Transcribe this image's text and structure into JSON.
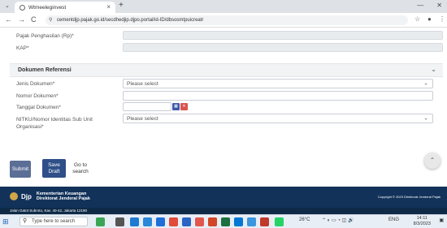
{
  "browser": {
    "tab_title": "Wtmeeleginvest",
    "url": "cementdjp.pajak.go.id/secdhedjip.djpo.portal/id-ID/dbsosmtpuicreatr",
    "new_tab": "+",
    "back": "←",
    "forward": "→",
    "reload": "C",
    "close_tab": "×",
    "tab_menu": "⌄",
    "window_controls": [
      "⌄",
      "—",
      "□",
      "✕"
    ]
  },
  "form": {
    "pph_label": "Pajak Penghasilan (Rp)*",
    "kap_label": "KAP*",
    "section_title": "Dokumen Referensi",
    "jenis_label": "Jenis Dokumen*",
    "jenis_value": "Please select",
    "nomor_label": "Nomor Dokumen*",
    "tanggal_label": "Tanggal Dokumen*",
    "nitku_label": "NITKU/Nomor Identitas Sub Unit Organisasi*",
    "nitku_value": "Please select"
  },
  "actions": {
    "submit": "Submit",
    "save_draft": "Save Draft",
    "go_search": "Go to search"
  },
  "footer": {
    "org_line1": "Kementerian Keuangan",
    "org_line2": "Direktorat Jenderal Pajak",
    "logo_text": "Djp",
    "address": "Jalan Gatot Subroto, Kav. 40-42, Jakarta 12190",
    "copyright": "Copyright © 2023 Direktorat Jenderal Pajak"
  },
  "taskbar": {
    "search_placeholder": "Type here to search",
    "temperature": "26°C",
    "time": "14:11",
    "date": "8/3/2023",
    "lang": "ENG"
  },
  "colors": {
    "primary": "#2f4f88",
    "footer": "#12325a",
    "calendar_blue": "#3d5aa8",
    "calendar_red": "#d9534f"
  }
}
